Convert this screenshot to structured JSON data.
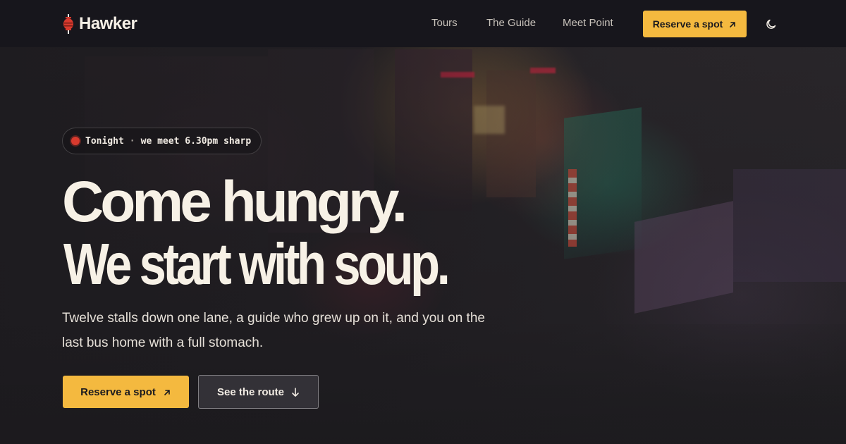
{
  "brand": {
    "name": "Hawker",
    "logo_icon": "lantern-icon",
    "logo_color": "#d83a2e"
  },
  "nav": {
    "links": [
      {
        "label": "Tours"
      },
      {
        "label": "The Guide"
      },
      {
        "label": "Meet Point"
      }
    ],
    "cta_label": "Reserve a spot",
    "cta_icon": "arrow-up-right-icon",
    "theme_toggle_icon": "moon-icon"
  },
  "hero": {
    "badge": {
      "status_icon": "live-dot-icon",
      "label": "Tonight",
      "separator": "·",
      "detail": "we meet 6.30pm sharp"
    },
    "headline_line1": "Come hungry.",
    "headline_line2": "We start with soup.",
    "lede": "Twelve stalls down one lane, a guide who grew up on it, and you on the last bus home with a full stomach.",
    "primary_cta": {
      "label": "Reserve a spot",
      "icon": "arrow-up-right-icon"
    },
    "secondary_cta": {
      "label": "See the route",
      "icon": "arrow-down-icon"
    }
  },
  "colors": {
    "accent": "#f4b93f",
    "nav_background": "#17161c",
    "text": "#f7f1e6",
    "live_dot": "#d83a2e"
  }
}
